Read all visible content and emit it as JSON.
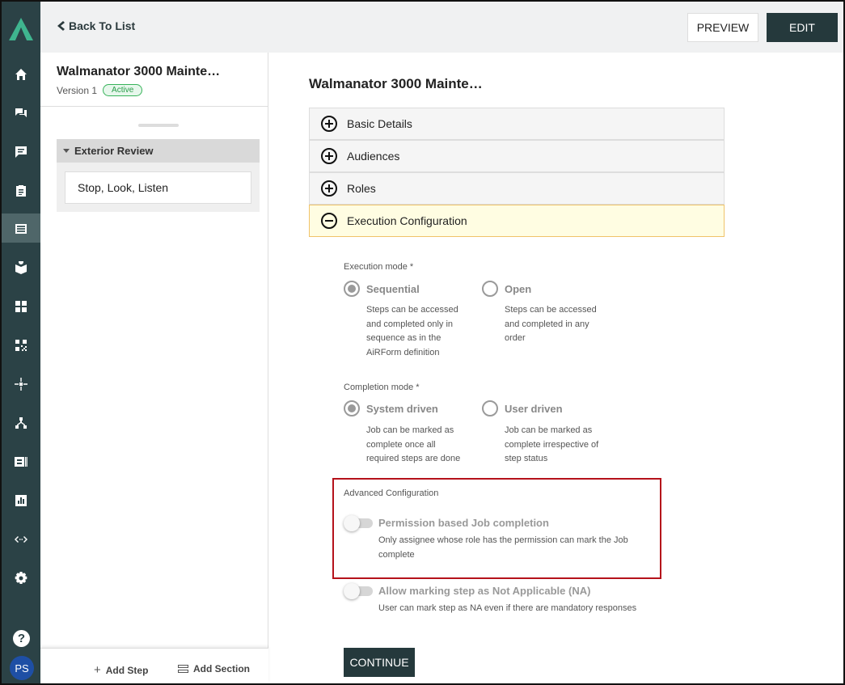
{
  "topbar": {
    "back_label": "Back To List",
    "preview_label": "PREVIEW",
    "edit_label": "EDIT"
  },
  "rail": {
    "items": [
      "home-icon",
      "chat-icon",
      "message-icon",
      "clipboard-icon",
      "form-icon",
      "book-icon",
      "dashboard-icon",
      "qr-icon",
      "hub-icon",
      "network-icon",
      "id-card-icon",
      "report-icon",
      "code-icon",
      "gear-icon"
    ],
    "help_label": "?",
    "avatar_initials": "PS",
    "colors": {
      "rail_bg": "#2b4246",
      "avatar_bg": "#1e4fa5"
    }
  },
  "left_panel": {
    "title": "Walmanator 3000 Mainte…",
    "version": "Version 1",
    "status_badge": "Active",
    "section": {
      "label": "Exterior Review",
      "steps": [
        "Stop, Look, Listen"
      ]
    },
    "add_step_label": "Add Step",
    "add_section_label": "Add Section"
  },
  "main": {
    "title": "Walmanator 3000 Mainte…",
    "accordions": [
      {
        "label": "Basic Details",
        "expanded": false
      },
      {
        "label": "Audiences",
        "expanded": false
      },
      {
        "label": "Roles",
        "expanded": false
      },
      {
        "label": "Execution Configuration",
        "expanded": true
      }
    ],
    "execution_mode": {
      "label": "Execution mode *",
      "options": [
        {
          "label": "Sequential",
          "selected": true,
          "desc_lines": [
            "Steps can be accessed",
            "and completed only in",
            "sequence as in the",
            "AiRForm definition"
          ]
        },
        {
          "label": "Open",
          "selected": false,
          "desc_lines": [
            "Steps can be accessed",
            "and completed in any",
            "order"
          ]
        }
      ]
    },
    "completion_mode": {
      "label": "Completion mode *",
      "options": [
        {
          "label": "System driven",
          "selected": true,
          "desc_lines": [
            "Job can be marked as",
            "complete once all",
            "required steps are done"
          ]
        },
        {
          "label": "User driven",
          "selected": false,
          "desc_lines": [
            "Job can be marked as",
            "complete irrespective of",
            "step status"
          ]
        }
      ]
    },
    "advanced": {
      "label": "Advanced Configuration",
      "toggles": [
        {
          "label": "Permission based Job completion",
          "on": false,
          "desc_lines": [
            "Only assignee whose role has the permission can mark the Job",
            "complete"
          ]
        },
        {
          "label": "Allow marking step as Not Applicable (NA)",
          "on": false,
          "desc_lines": [
            "User can mark step as NA even if there are mandatory responses"
          ]
        }
      ]
    },
    "continue_label": "CONTINUE",
    "colors": {
      "primary": "#25393c",
      "highlight_border": "#b5121b",
      "expanded_bg": "#fffde2"
    }
  }
}
